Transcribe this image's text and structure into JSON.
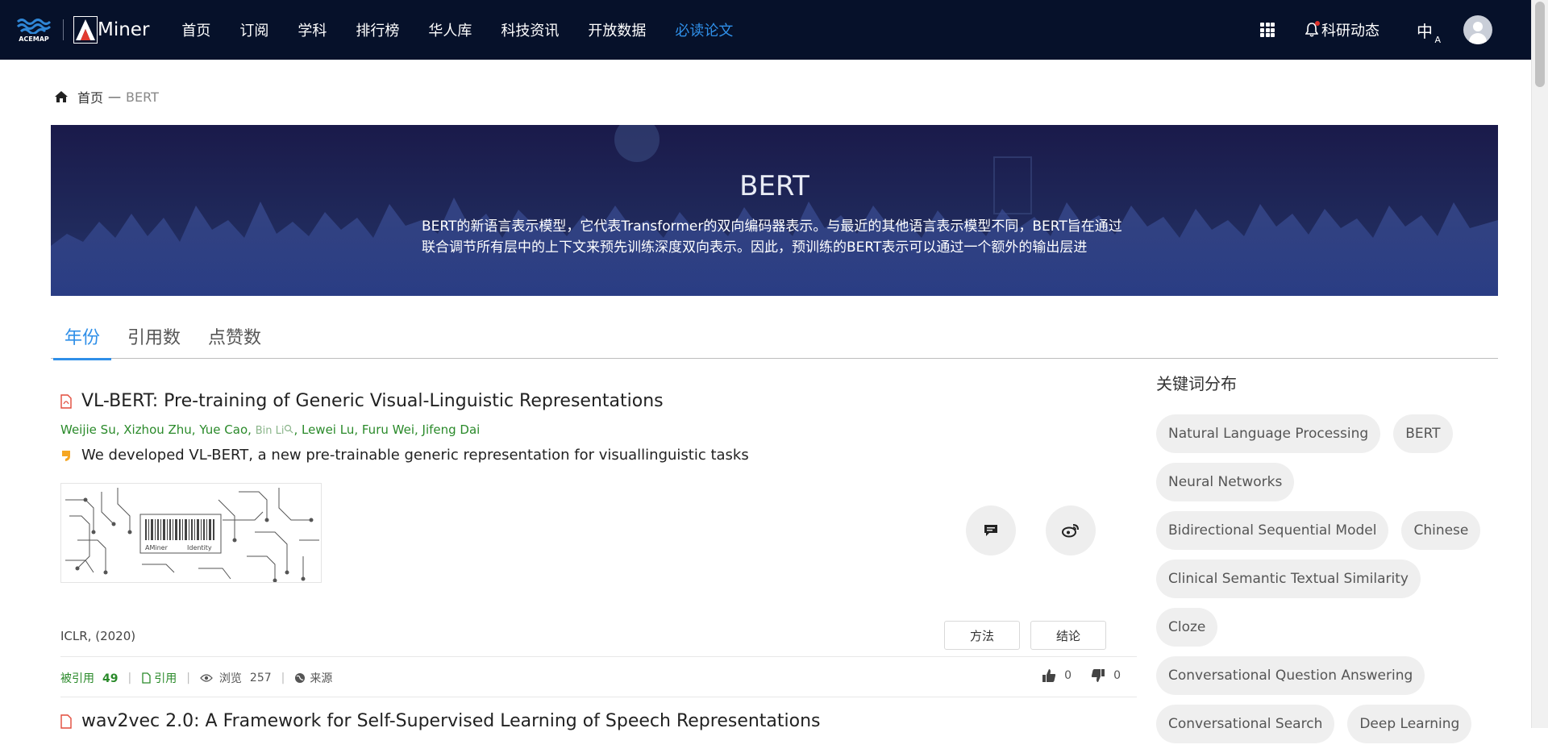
{
  "nav": {
    "acemap_text": "ACEMAP",
    "aminer_text": "Miner",
    "links": [
      "首页",
      "订阅",
      "学科",
      "排行榜",
      "华人库",
      "科技资讯",
      "开放数据",
      "必读论文"
    ],
    "active_index": 7,
    "research_news": "科研动态",
    "lang_main": "中",
    "lang_sub": "A"
  },
  "breadcrumb": {
    "home": "首页",
    "separator": "一",
    "current": "BERT"
  },
  "banner": {
    "title": "BERT",
    "description": "BERT的新语言表示模型，它代表Transformer的双向编码器表示。与最近的其他语言表示模型不同，BERT旨在通过联合调节所有层中的上下文来预先训练深度双向表示。因此，预训练的BERT表示可以通过一个额外的输出层进"
  },
  "tabs": [
    "年份",
    "引用数",
    "点赞数"
  ],
  "paper": {
    "title": "VL-BERT: Pre-training of Generic Visual-Linguistic Representations",
    "authors_before": "Weijie Su, Xizhou Zhu, Yue Cao,",
    "author_unlinked": "Bin Li",
    "authors_after": ", Lewei Lu, Furu Wei, Jifeng Dai",
    "summary": "We developed VL-BERT, a new pre-trainable generic representation for visuallinguistic tasks",
    "image_labels": [
      "AMiner",
      "Identity"
    ],
    "venue": "ICLR, (2020)",
    "tag_method": "方法",
    "tag_conclusion": "结论",
    "cited_label": "被引用",
    "cited_count": "49",
    "cite_label": "引用",
    "views_label": "浏览",
    "views_count": "257",
    "source_label": "来源",
    "likes": "0",
    "dislikes": "0"
  },
  "next_paper": {
    "title": "wav2vec 2.0: A Framework for Self-Supervised Learning of Speech Representations"
  },
  "keywords": {
    "title": "关键词分布",
    "items": [
      "Natural Language Processing",
      "BERT",
      "Neural Networks",
      "Bidirectional Sequential Model",
      "Chinese",
      "Clinical Semantic Textual Similarity",
      "Cloze",
      "Conversational Question Answering",
      "Conversational Search",
      "Deep Learning"
    ]
  },
  "colors": {
    "nav_bg": "#06112a",
    "accent": "#2f8fe8",
    "author_green": "#2a8a2a"
  }
}
